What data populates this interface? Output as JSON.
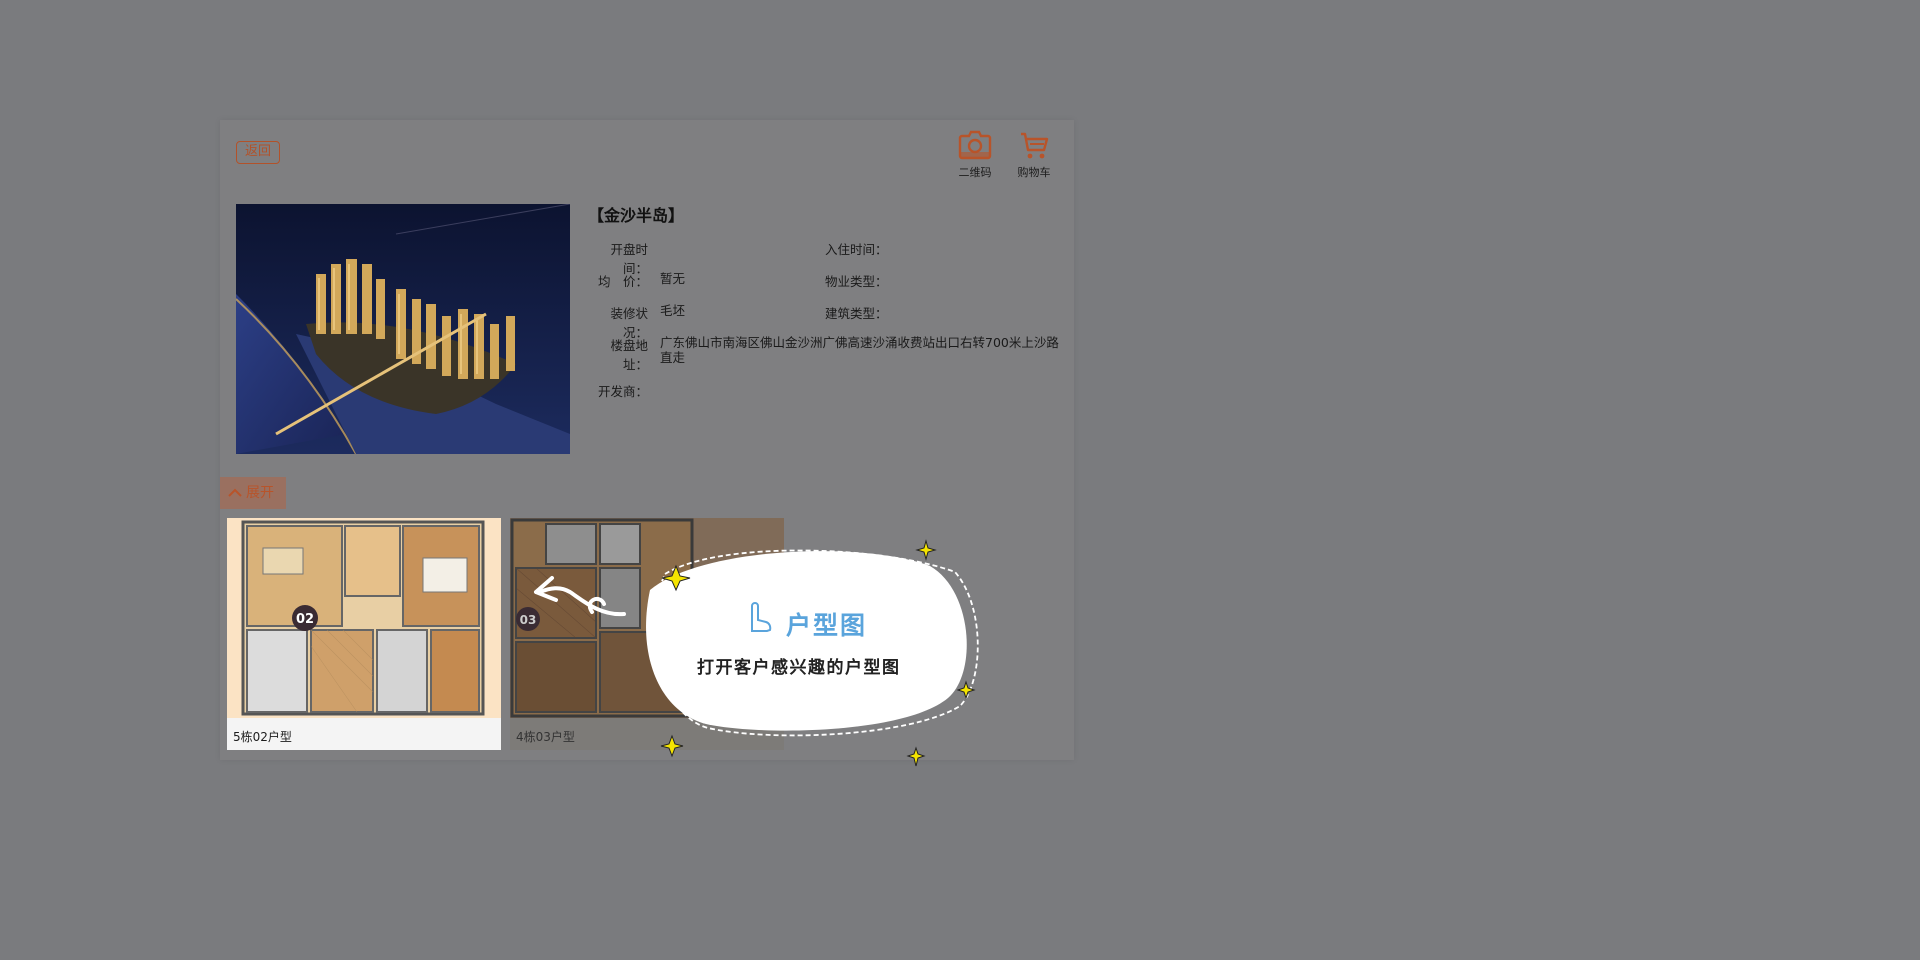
{
  "header": {
    "back_label": "返回",
    "qr_label": "二维码",
    "cart_label": "购物车",
    "accent_color": "#b2522a"
  },
  "property": {
    "title": "【金沙半岛】",
    "fields": {
      "open_time_label": "开盘时间：",
      "open_time_value": "",
      "move_in_label": "入住时间：",
      "move_in_value": "",
      "avg_price_label": "均　价：",
      "avg_price_value": "暂无",
      "property_type_label": "物业类型：",
      "property_type_value": "",
      "decoration_label": "装修状况：",
      "decoration_value": "毛坯",
      "building_type_label": "建筑类型：",
      "building_type_value": "",
      "address_label": "楼盘地址：",
      "address_value": "广东佛山市南海区佛山金沙洲广佛高速沙涌收费站出口右转700米上沙路直走",
      "developer_label": "开发商：",
      "developer_value": ""
    }
  },
  "floorplans": {
    "expand_label": "展开",
    "items": [
      {
        "caption": "5栋02户型",
        "badge": "02"
      },
      {
        "caption": "4栋03户型",
        "badge": "03"
      }
    ]
  },
  "tooltip": {
    "title": "户型图",
    "subtitle": "打开客户感兴趣的户型图",
    "title_color": "#5aa4dc"
  }
}
